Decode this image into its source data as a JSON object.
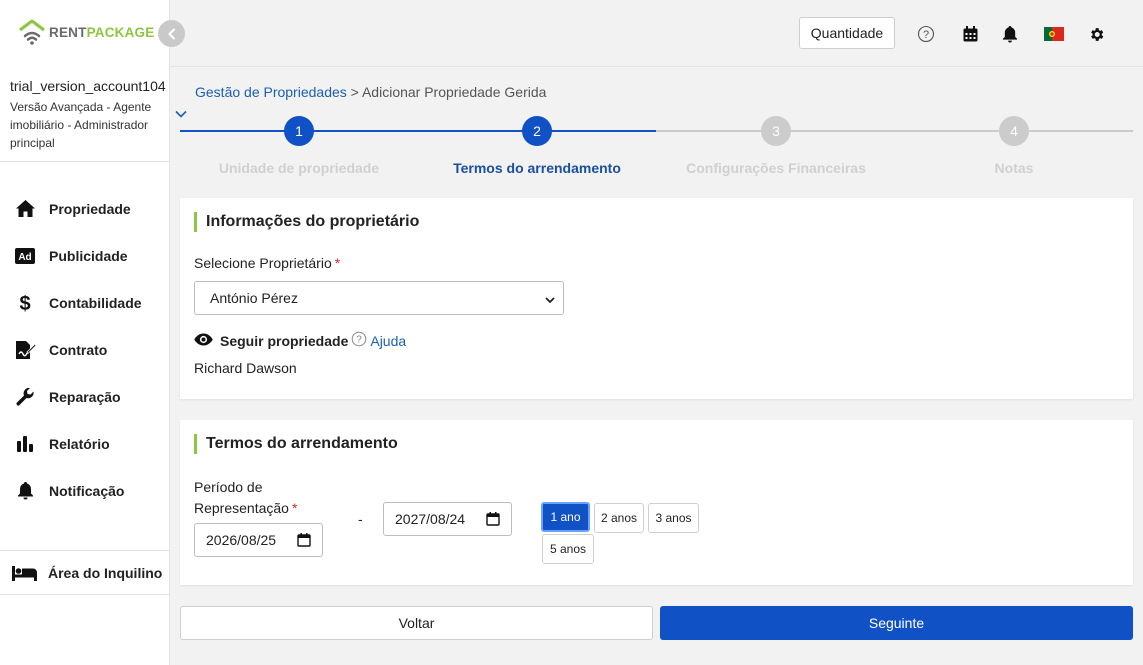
{
  "app": {
    "logo_part1": "RENT",
    "logo_part2": "PACKAGE"
  },
  "account": {
    "name": "trial_version_account104",
    "role": "Versão Avançada - Agente imobiliário - Administrador principal"
  },
  "sidebar": {
    "items": [
      {
        "label": "Propriedade",
        "icon": "home-icon"
      },
      {
        "label": "Publicidade",
        "icon": "ad-icon"
      },
      {
        "label": "Contabilidade",
        "icon": "dollar-icon"
      },
      {
        "label": "Contrato",
        "icon": "contract-icon"
      },
      {
        "label": "Reparação",
        "icon": "wrench-icon"
      },
      {
        "label": "Relatório",
        "icon": "bar-chart-icon"
      },
      {
        "label": "Notificação",
        "icon": "bell-icon"
      }
    ],
    "tenant_area": "Área do Inquilino"
  },
  "topbar": {
    "quantity_label": "Quantidade",
    "icons": [
      "help-icon",
      "calendar-icon",
      "bell-icon",
      "portugal-flag-icon",
      "gear-icon"
    ]
  },
  "breadcrumb": {
    "parent": "Gestão de Propriedades",
    "separator": ">",
    "current": "Adicionar Propriedade Gerida"
  },
  "stepper": {
    "current_step": 2,
    "steps": [
      {
        "number": "1",
        "label": "Unidade de propriedade"
      },
      {
        "number": "2",
        "label": "Termos do arrendamento"
      },
      {
        "number": "3",
        "label": "Configurações Financeiras"
      },
      {
        "number": "4",
        "label": "Notas"
      }
    ]
  },
  "owner_card": {
    "title": "Informações do proprietário",
    "select_label": "Selecione Proprietário",
    "required_mark": "*",
    "selected_owner": "António Pérez",
    "follow_label": "Seguir propriedade",
    "help_link": "Ajuda",
    "follower_name": "Richard Dawson"
  },
  "lease_card": {
    "title": "Termos do arrendamento",
    "period_label_line1": "Período de",
    "period_label_line2": "Representação",
    "required_mark": "*",
    "start_date": "2026/08/25",
    "separator": "-",
    "end_date": "2027/08/24",
    "durations": [
      "1 ano",
      "2 anos",
      "3 anos",
      "5 anos"
    ],
    "selected_duration": "1 ano"
  },
  "footer": {
    "back_label": "Voltar",
    "next_label": "Seguinte"
  },
  "colors": {
    "primary": "#1151c6",
    "brand_green": "#8cc63f",
    "link": "#1b5fb3",
    "inactive_step": "#cccccc",
    "required": "#d9262c"
  }
}
